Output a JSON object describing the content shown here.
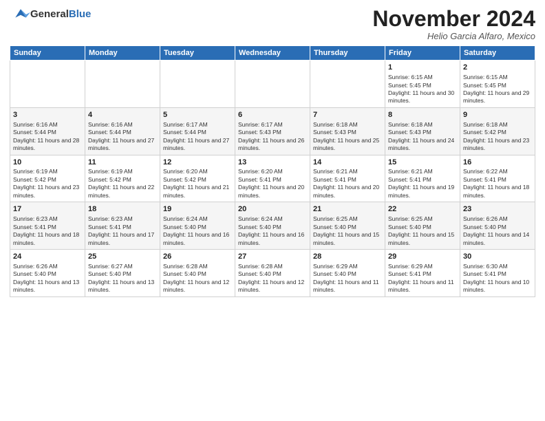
{
  "logo": {
    "general": "General",
    "blue": "Blue"
  },
  "header": {
    "month": "November 2024",
    "location": "Helio Garcia Alfaro, Mexico"
  },
  "days_of_week": [
    "Sunday",
    "Monday",
    "Tuesday",
    "Wednesday",
    "Thursday",
    "Friday",
    "Saturday"
  ],
  "weeks": [
    [
      {
        "day": "",
        "info": ""
      },
      {
        "day": "",
        "info": ""
      },
      {
        "day": "",
        "info": ""
      },
      {
        "day": "",
        "info": ""
      },
      {
        "day": "",
        "info": ""
      },
      {
        "day": "1",
        "info": "Sunrise: 6:15 AM\nSunset: 5:45 PM\nDaylight: 11 hours and 30 minutes."
      },
      {
        "day": "2",
        "info": "Sunrise: 6:15 AM\nSunset: 5:45 PM\nDaylight: 11 hours and 29 minutes."
      }
    ],
    [
      {
        "day": "3",
        "info": "Sunrise: 6:16 AM\nSunset: 5:44 PM\nDaylight: 11 hours and 28 minutes."
      },
      {
        "day": "4",
        "info": "Sunrise: 6:16 AM\nSunset: 5:44 PM\nDaylight: 11 hours and 27 minutes."
      },
      {
        "day": "5",
        "info": "Sunrise: 6:17 AM\nSunset: 5:44 PM\nDaylight: 11 hours and 27 minutes."
      },
      {
        "day": "6",
        "info": "Sunrise: 6:17 AM\nSunset: 5:43 PM\nDaylight: 11 hours and 26 minutes."
      },
      {
        "day": "7",
        "info": "Sunrise: 6:18 AM\nSunset: 5:43 PM\nDaylight: 11 hours and 25 minutes."
      },
      {
        "day": "8",
        "info": "Sunrise: 6:18 AM\nSunset: 5:43 PM\nDaylight: 11 hours and 24 minutes."
      },
      {
        "day": "9",
        "info": "Sunrise: 6:18 AM\nSunset: 5:42 PM\nDaylight: 11 hours and 23 minutes."
      }
    ],
    [
      {
        "day": "10",
        "info": "Sunrise: 6:19 AM\nSunset: 5:42 PM\nDaylight: 11 hours and 23 minutes."
      },
      {
        "day": "11",
        "info": "Sunrise: 6:19 AM\nSunset: 5:42 PM\nDaylight: 11 hours and 22 minutes."
      },
      {
        "day": "12",
        "info": "Sunrise: 6:20 AM\nSunset: 5:42 PM\nDaylight: 11 hours and 21 minutes."
      },
      {
        "day": "13",
        "info": "Sunrise: 6:20 AM\nSunset: 5:41 PM\nDaylight: 11 hours and 20 minutes."
      },
      {
        "day": "14",
        "info": "Sunrise: 6:21 AM\nSunset: 5:41 PM\nDaylight: 11 hours and 20 minutes."
      },
      {
        "day": "15",
        "info": "Sunrise: 6:21 AM\nSunset: 5:41 PM\nDaylight: 11 hours and 19 minutes."
      },
      {
        "day": "16",
        "info": "Sunrise: 6:22 AM\nSunset: 5:41 PM\nDaylight: 11 hours and 18 minutes."
      }
    ],
    [
      {
        "day": "17",
        "info": "Sunrise: 6:23 AM\nSunset: 5:41 PM\nDaylight: 11 hours and 18 minutes."
      },
      {
        "day": "18",
        "info": "Sunrise: 6:23 AM\nSunset: 5:41 PM\nDaylight: 11 hours and 17 minutes."
      },
      {
        "day": "19",
        "info": "Sunrise: 6:24 AM\nSunset: 5:40 PM\nDaylight: 11 hours and 16 minutes."
      },
      {
        "day": "20",
        "info": "Sunrise: 6:24 AM\nSunset: 5:40 PM\nDaylight: 11 hours and 16 minutes."
      },
      {
        "day": "21",
        "info": "Sunrise: 6:25 AM\nSunset: 5:40 PM\nDaylight: 11 hours and 15 minutes."
      },
      {
        "day": "22",
        "info": "Sunrise: 6:25 AM\nSunset: 5:40 PM\nDaylight: 11 hours and 15 minutes."
      },
      {
        "day": "23",
        "info": "Sunrise: 6:26 AM\nSunset: 5:40 PM\nDaylight: 11 hours and 14 minutes."
      }
    ],
    [
      {
        "day": "24",
        "info": "Sunrise: 6:26 AM\nSunset: 5:40 PM\nDaylight: 11 hours and 13 minutes."
      },
      {
        "day": "25",
        "info": "Sunrise: 6:27 AM\nSunset: 5:40 PM\nDaylight: 11 hours and 13 minutes."
      },
      {
        "day": "26",
        "info": "Sunrise: 6:28 AM\nSunset: 5:40 PM\nDaylight: 11 hours and 12 minutes."
      },
      {
        "day": "27",
        "info": "Sunrise: 6:28 AM\nSunset: 5:40 PM\nDaylight: 11 hours and 12 minutes."
      },
      {
        "day": "28",
        "info": "Sunrise: 6:29 AM\nSunset: 5:40 PM\nDaylight: 11 hours and 11 minutes."
      },
      {
        "day": "29",
        "info": "Sunrise: 6:29 AM\nSunset: 5:41 PM\nDaylight: 11 hours and 11 minutes."
      },
      {
        "day": "30",
        "info": "Sunrise: 6:30 AM\nSunset: 5:41 PM\nDaylight: 11 hours and 10 minutes."
      }
    ]
  ]
}
